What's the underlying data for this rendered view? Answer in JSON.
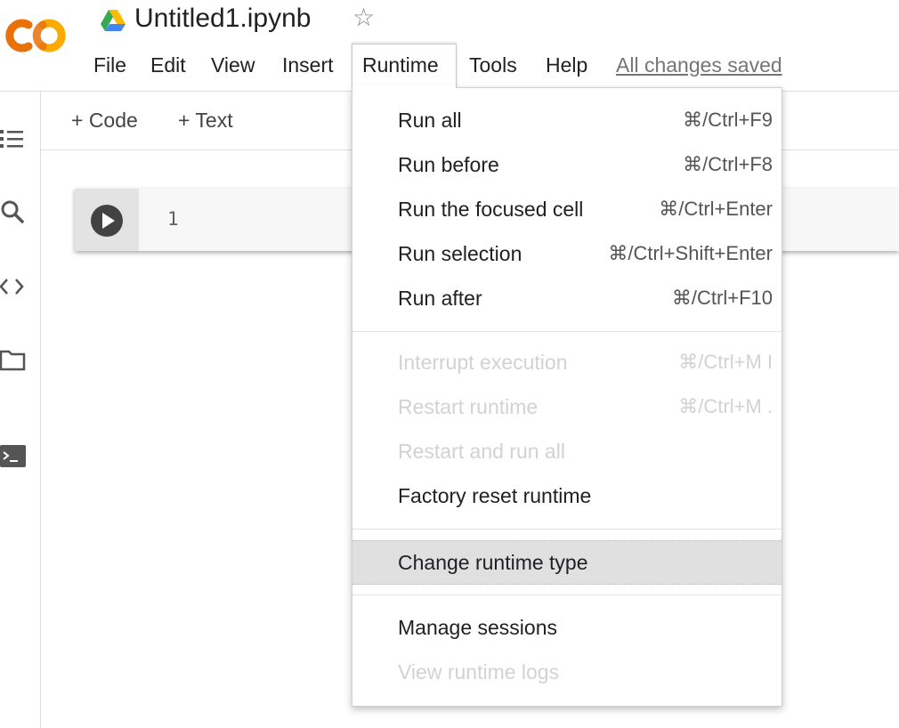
{
  "header": {
    "title": "Untitled1.ipynb",
    "menu": [
      "File",
      "Edit",
      "View",
      "Insert",
      "Runtime",
      "Tools",
      "Help"
    ],
    "save_status": "All changes saved"
  },
  "toolbar": {
    "add_code": "+ Code",
    "add_text": "+ Text"
  },
  "cell": {
    "line_number": "1"
  },
  "dropdown": {
    "items": [
      {
        "label": "Run all",
        "shortcut": "⌘/Ctrl+F9",
        "enabled": true
      },
      {
        "label": "Run before",
        "shortcut": "⌘/Ctrl+F8",
        "enabled": true
      },
      {
        "label": "Run the focused cell",
        "shortcut": "⌘/Ctrl+Enter",
        "enabled": true
      },
      {
        "label": "Run selection",
        "shortcut": "⌘/Ctrl+Shift+Enter",
        "enabled": true
      },
      {
        "label": "Run after",
        "shortcut": "⌘/Ctrl+F10",
        "enabled": true
      },
      {
        "label": "Interrupt execution",
        "shortcut": "⌘/Ctrl+M I",
        "enabled": false
      },
      {
        "label": "Restart runtime",
        "shortcut": "⌘/Ctrl+M .",
        "enabled": false
      },
      {
        "label": "Restart and run all",
        "shortcut": "",
        "enabled": false
      },
      {
        "label": "Factory reset runtime",
        "shortcut": "",
        "enabled": true
      },
      {
        "label": "Change runtime type",
        "shortcut": "",
        "enabled": true,
        "highlighted": true
      },
      {
        "label": "Manage sessions",
        "shortcut": "",
        "enabled": true
      },
      {
        "label": "View runtime logs",
        "shortcut": "",
        "enabled": false
      }
    ]
  },
  "colors": {
    "logo_orange": "#F9AB00",
    "logo_dark_orange": "#E8710A",
    "highlight_bg": "#E0E0E0",
    "disabled_text": "#D2D2D2"
  },
  "icons": {
    "logo": "colab-logo",
    "drive": "google-drive-icon",
    "star": "star-outline-icon",
    "rail": [
      "table-of-contents-icon",
      "search-icon",
      "code-snippets-icon",
      "files-folder-icon",
      "terminal-icon"
    ],
    "run": "play-icon"
  }
}
